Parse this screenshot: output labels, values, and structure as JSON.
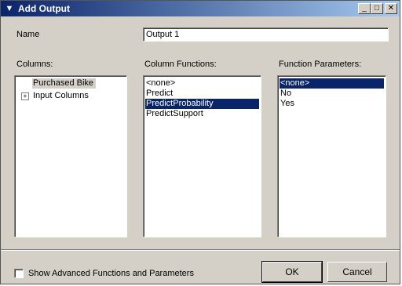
{
  "window": {
    "title": "Add Output",
    "icon": "mining-model-icon",
    "controls": {
      "minimize": "_",
      "maximize": "□",
      "close": "✕"
    }
  },
  "name_field": {
    "label": "Name",
    "value": "Output 1"
  },
  "columns": {
    "label": "Columns:",
    "items": [
      {
        "label": "Purchased Bike",
        "selected": "inactive"
      },
      {
        "label": "Input Columns",
        "expandable": "+"
      }
    ]
  },
  "column_functions": {
    "label": "Column Functions:",
    "items": [
      "<none>",
      "Predict",
      "PredictProbability",
      "PredictSupport"
    ],
    "selected": "PredictProbability"
  },
  "function_parameters": {
    "label": "Function Parameters:",
    "items": [
      "<none>",
      "No",
      "Yes"
    ],
    "selected": "<none>"
  },
  "advanced_checkbox": {
    "label": "Show Advanced Functions and Parameters",
    "checked": false
  },
  "buttons": {
    "ok": "OK",
    "cancel": "Cancel"
  }
}
